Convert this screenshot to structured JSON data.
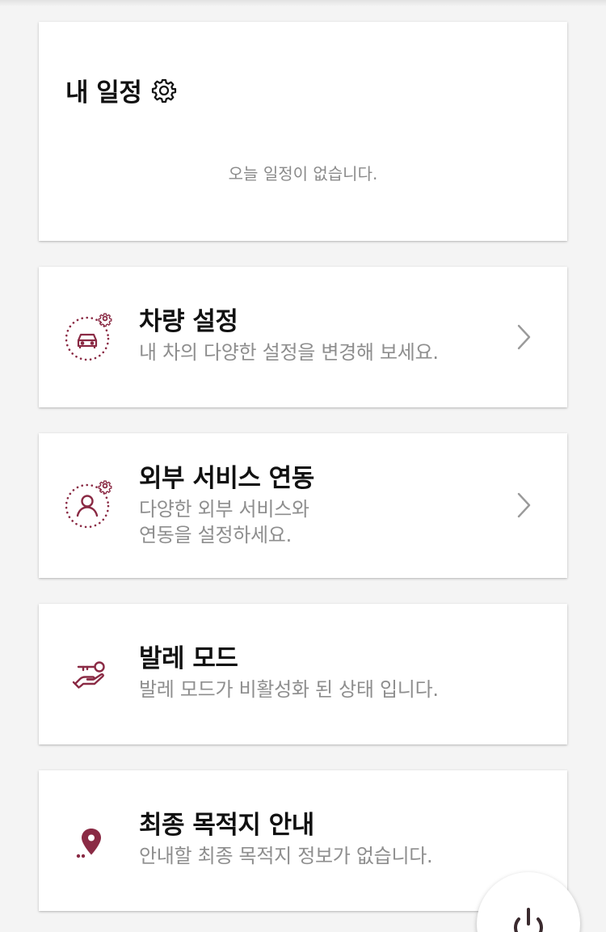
{
  "colors": {
    "accent": "#8a2a44",
    "title": "#111111",
    "muted": "#8e8e8e",
    "background": "#f4f4f4"
  },
  "schedule": {
    "title": "내 일정",
    "settings_icon": "gear-icon",
    "empty_message": "오늘 일정이 없습니다."
  },
  "menu": [
    {
      "id": "vehicle-settings",
      "icon": "car-gear-icon",
      "title": "차량 설정",
      "description": [
        "내 차의 다양한 설정을 변경해 보세요."
      ],
      "has_chevron": true
    },
    {
      "id": "external-services",
      "icon": "person-gear-icon",
      "title": "외부 서비스 연동",
      "description": [
        "다양한 외부 서비스와",
        "연동을 설정하세요."
      ],
      "has_chevron": true
    },
    {
      "id": "valet-mode",
      "icon": "key-hand-icon",
      "title": "발레 모드",
      "description": [
        "발레 모드가 비활성화 된 상태 입니다."
      ],
      "has_chevron": false
    },
    {
      "id": "final-destination",
      "icon": "location-pin-icon",
      "title": "최종 목적지 안내",
      "description": [
        "안내할 최종 목적지 정보가 없습니다."
      ],
      "has_chevron": false
    }
  ],
  "fab": {
    "icon": "power-icon"
  }
}
